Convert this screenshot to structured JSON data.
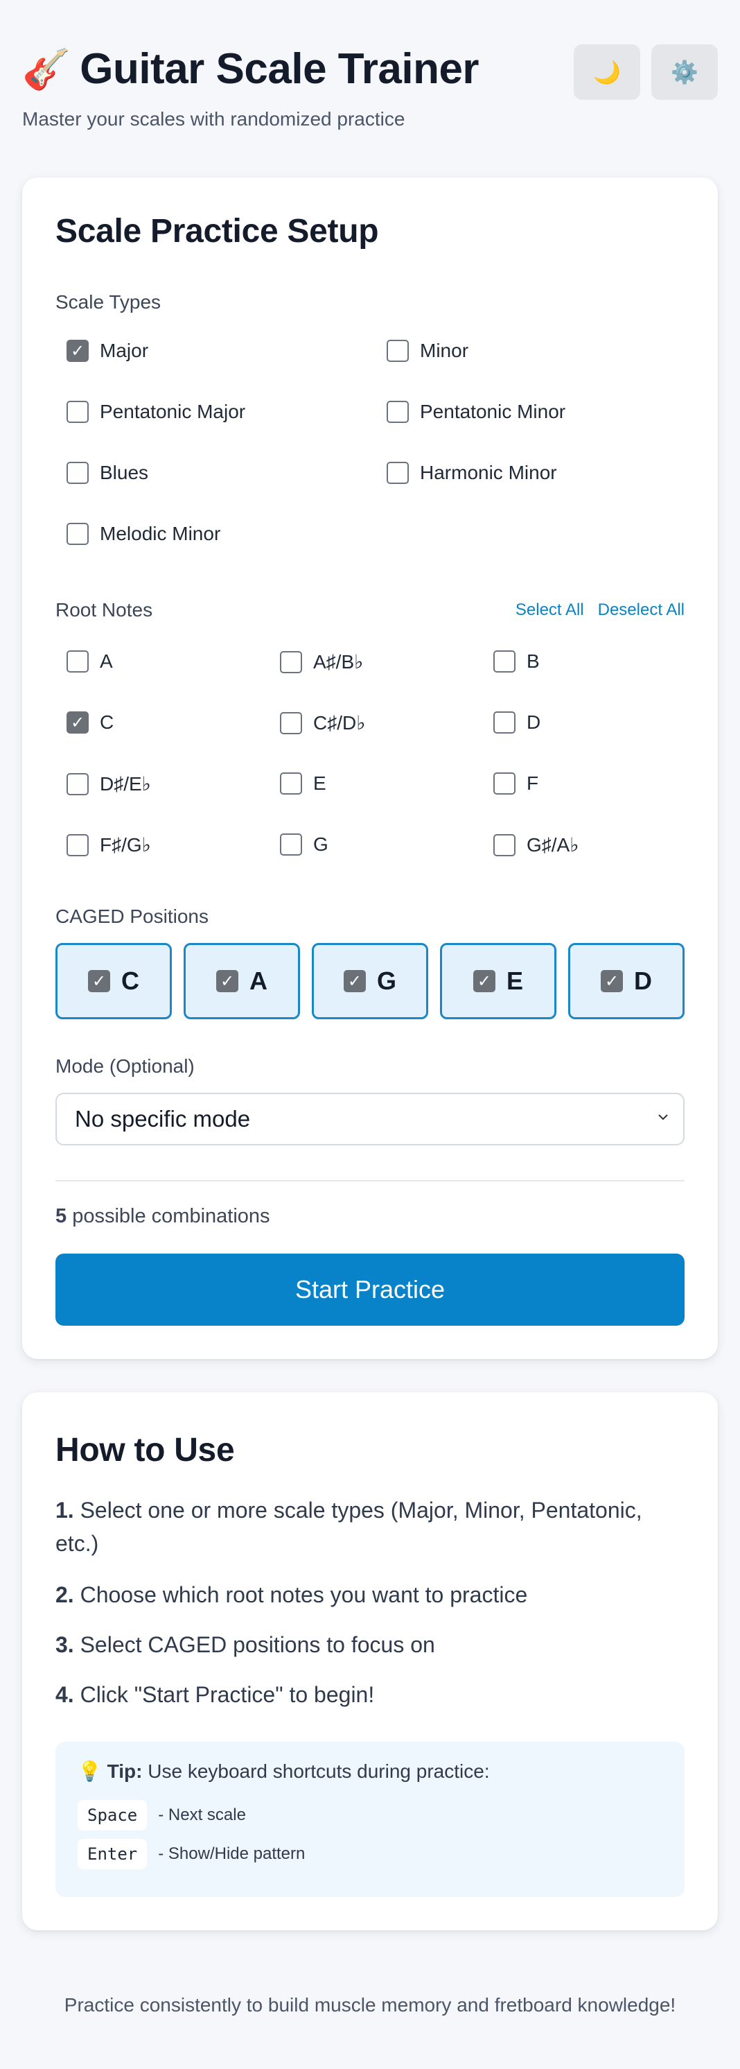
{
  "header": {
    "title": "Guitar Scale Trainer",
    "guitar_icon": "🎸",
    "subtitle": "Master your scales with randomized practice",
    "theme_icon": "🌙",
    "settings_icon": "⚙️"
  },
  "setup": {
    "title": "Scale Practice Setup",
    "scale_types_label": "Scale Types",
    "scale_types": [
      {
        "label": "Major",
        "checked": true
      },
      {
        "label": "Minor",
        "checked": false
      },
      {
        "label": "Pentatonic Major",
        "checked": false
      },
      {
        "label": "Pentatonic Minor",
        "checked": false
      },
      {
        "label": "Blues",
        "checked": false
      },
      {
        "label": "Harmonic Minor",
        "checked": false
      },
      {
        "label": "Melodic Minor",
        "checked": false
      }
    ],
    "root_notes_label": "Root Notes",
    "select_all": "Select All",
    "deselect_all": "Deselect All",
    "root_notes": [
      {
        "label": "A",
        "checked": false
      },
      {
        "label": "A♯/B♭",
        "checked": false
      },
      {
        "label": "B",
        "checked": false
      },
      {
        "label": "C",
        "checked": true
      },
      {
        "label": "C♯/D♭",
        "checked": false
      },
      {
        "label": "D",
        "checked": false
      },
      {
        "label": "D♯/E♭",
        "checked": false
      },
      {
        "label": "E",
        "checked": false
      },
      {
        "label": "F",
        "checked": false
      },
      {
        "label": "F♯/G♭",
        "checked": false
      },
      {
        "label": "G",
        "checked": false
      },
      {
        "label": "G♯/A♭",
        "checked": false
      }
    ],
    "caged_label": "CAGED Positions",
    "caged": [
      {
        "label": "C",
        "checked": true
      },
      {
        "label": "A",
        "checked": true
      },
      {
        "label": "G",
        "checked": true
      },
      {
        "label": "E",
        "checked": true
      },
      {
        "label": "D",
        "checked": true
      }
    ],
    "mode_label": "Mode (Optional)",
    "mode_value": "No specific mode",
    "combinations_count": "5",
    "combinations_text": "possible combinations",
    "start_button": "Start Practice",
    "check_glyph": "✓"
  },
  "howto": {
    "title": "How to Use",
    "steps": [
      {
        "num": "1.",
        "text": "Select one or more scale types (Major, Minor, Pentatonic, etc.)"
      },
      {
        "num": "2.",
        "text": "Choose which root notes you want to practice"
      },
      {
        "num": "3.",
        "text": "Select CAGED positions to focus on"
      },
      {
        "num": "4.",
        "text": "Click \"Start Practice\" to begin!"
      }
    ],
    "tip_icon": "💡",
    "tip_label": "Tip:",
    "tip_text": "Use keyboard shortcuts during practice:",
    "shortcuts": [
      {
        "key": "Space",
        "desc": "- Next scale"
      },
      {
        "key": "Enter",
        "desc": "- Show/Hide pattern"
      }
    ]
  },
  "footer": "Practice consistently to build muscle memory and fretboard knowledge!"
}
